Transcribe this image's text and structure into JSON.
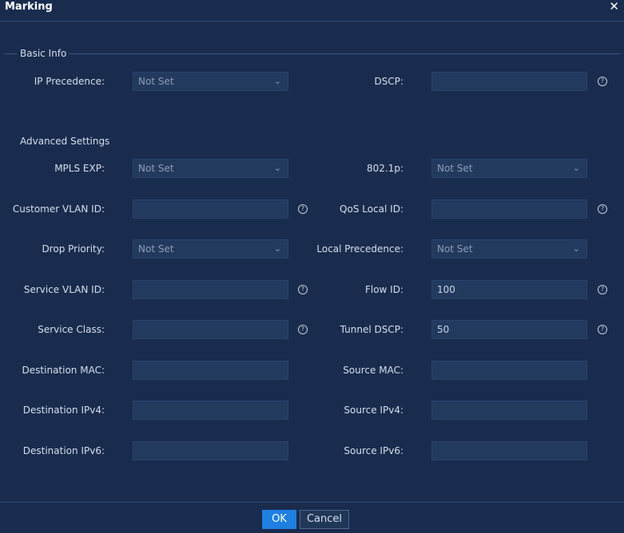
{
  "dialog": {
    "title": "Marking",
    "close_icon": "close-icon"
  },
  "basic_info": {
    "section_label": "Basic Info",
    "ip_precedence": {
      "label": "IP Precedence:",
      "value": "Not Set"
    },
    "dscp": {
      "label": "DSCP:",
      "value": ""
    }
  },
  "advanced": {
    "section_label": "Advanced Settings",
    "mpls_exp": {
      "label": "MPLS EXP:",
      "value": "Not Set"
    },
    "dot1p": {
      "label": "802.1p:",
      "value": "Not Set"
    },
    "customer_vlan_id": {
      "label": "Customer VLAN ID:",
      "value": ""
    },
    "qos_local_id": {
      "label": "QoS Local ID:",
      "value": ""
    },
    "drop_priority": {
      "label": "Drop Priority:",
      "value": "Not Set"
    },
    "local_precedence": {
      "label": "Local Precedence:",
      "value": "Not Set"
    },
    "service_vlan_id": {
      "label": "Service VLAN ID:",
      "value": ""
    },
    "flow_id": {
      "label": "Flow ID:",
      "value": "100"
    },
    "service_class": {
      "label": "Service Class:",
      "value": ""
    },
    "tunnel_dscp": {
      "label": "Tunnel DSCP:",
      "value": "50"
    },
    "destination_mac": {
      "label": "Destination MAC:",
      "value": ""
    },
    "source_mac": {
      "label": "Source MAC:",
      "value": ""
    },
    "destination_ipv4": {
      "label": "Destination IPv4:",
      "value": ""
    },
    "source_ipv4": {
      "label": "Source IPv4:",
      "value": ""
    },
    "destination_ipv6": {
      "label": "Destination IPv6:",
      "value": ""
    },
    "source_ipv6": {
      "label": "Source IPv6:",
      "value": ""
    }
  },
  "footer": {
    "ok_label": "OK",
    "cancel_label": "Cancel"
  },
  "icons": {
    "help": "help-icon",
    "dropdown": "chevron-down-icon"
  },
  "colors": {
    "background": "#192c4e",
    "field": "#233a5f",
    "primary": "#1f7fe3"
  }
}
